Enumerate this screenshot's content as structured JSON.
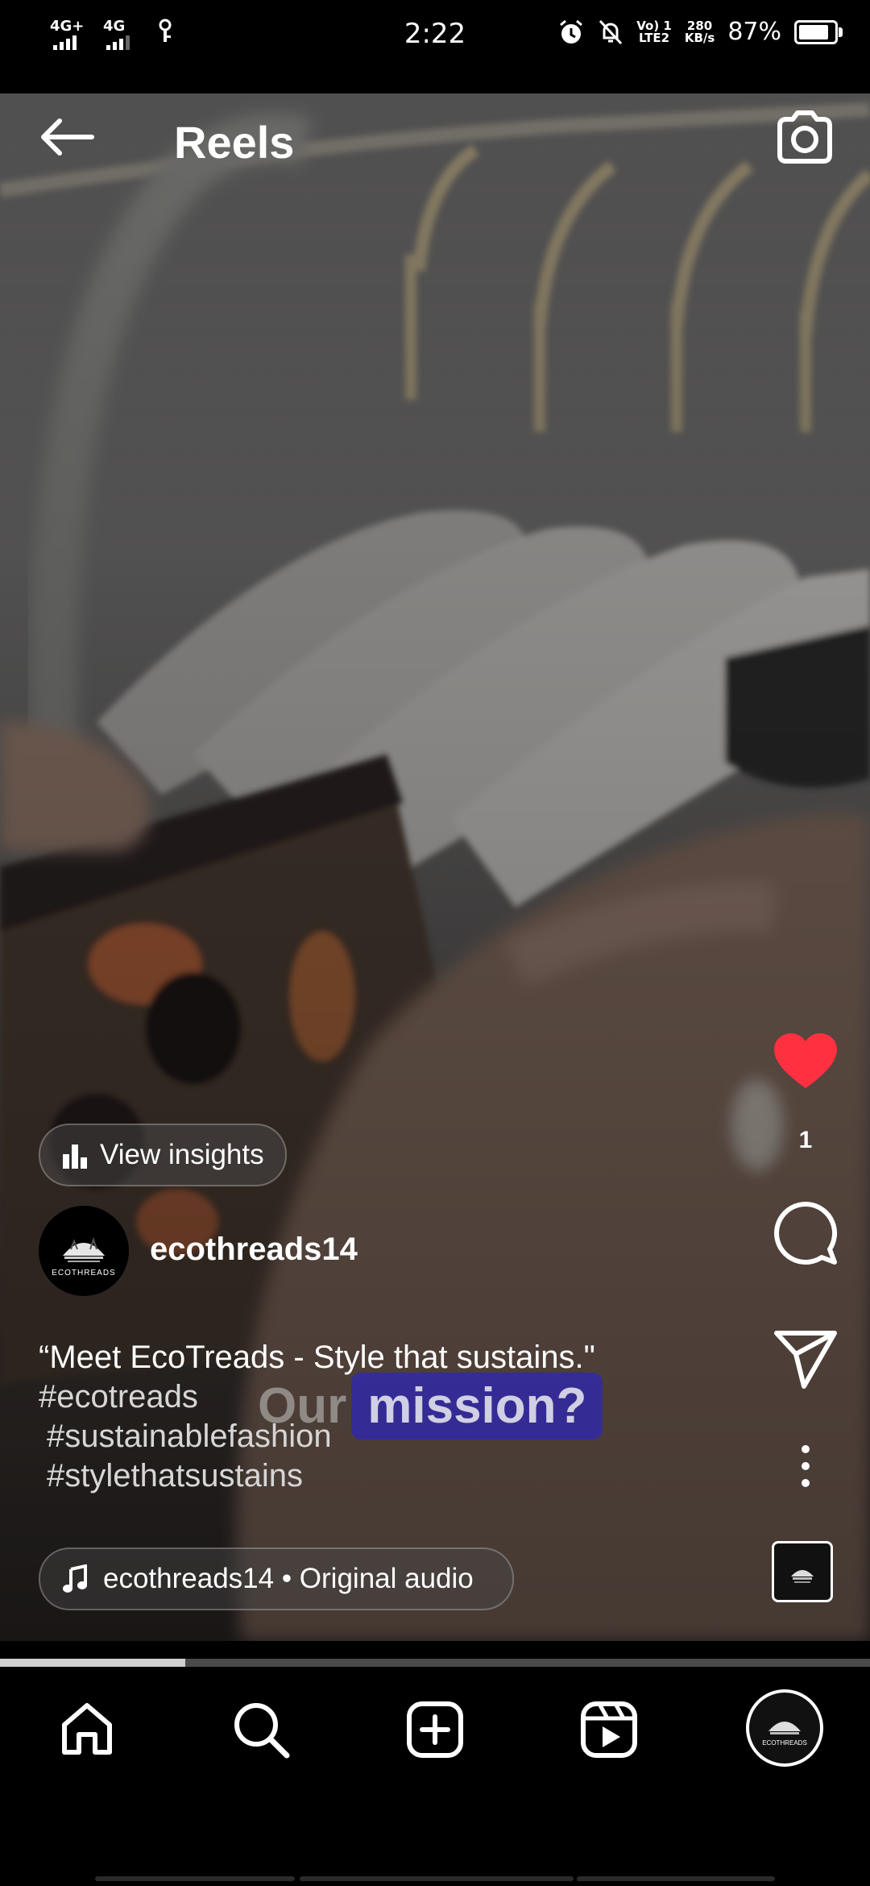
{
  "status_bar": {
    "network1": "4G+",
    "network2": "4G",
    "time": "2:22",
    "volte": "Vo) 1",
    "lte": "LTE2",
    "speed_value": "280",
    "speed_unit": "KB/s",
    "battery_percent": "87%",
    "battery_level": 0.87
  },
  "header": {
    "title": "Reels",
    "back_icon": "arrow-left-icon",
    "camera_icon": "camera-icon"
  },
  "actions": {
    "like_count": "1",
    "like_color": "#ff3040",
    "icons": [
      "heart-icon",
      "comment-icon",
      "share-icon",
      "more-icon"
    ]
  },
  "post": {
    "insights_label": "View insights",
    "username": "ecothreads14",
    "avatar_brand": "ECOTHREADS",
    "caption": "“Meet EcoTreads - Style that sustains.\"",
    "hashtags": [
      "#ecotreads",
      "#sustainablefashion",
      "#stylethatsustains"
    ],
    "overlay_word1": "Our",
    "overlay_word2": "mission?",
    "audio_label": "ecothreads14 • Original audio"
  },
  "progress": {
    "fraction": 0.213
  },
  "nav": {
    "items": [
      "home-icon",
      "search-icon",
      "create-icon",
      "reels-icon",
      "profile-avatar"
    ],
    "profile_brand": "ECOTHREADS"
  },
  "colors": {
    "accent": "#ff3040",
    "overlay_highlight": "#3026af"
  }
}
